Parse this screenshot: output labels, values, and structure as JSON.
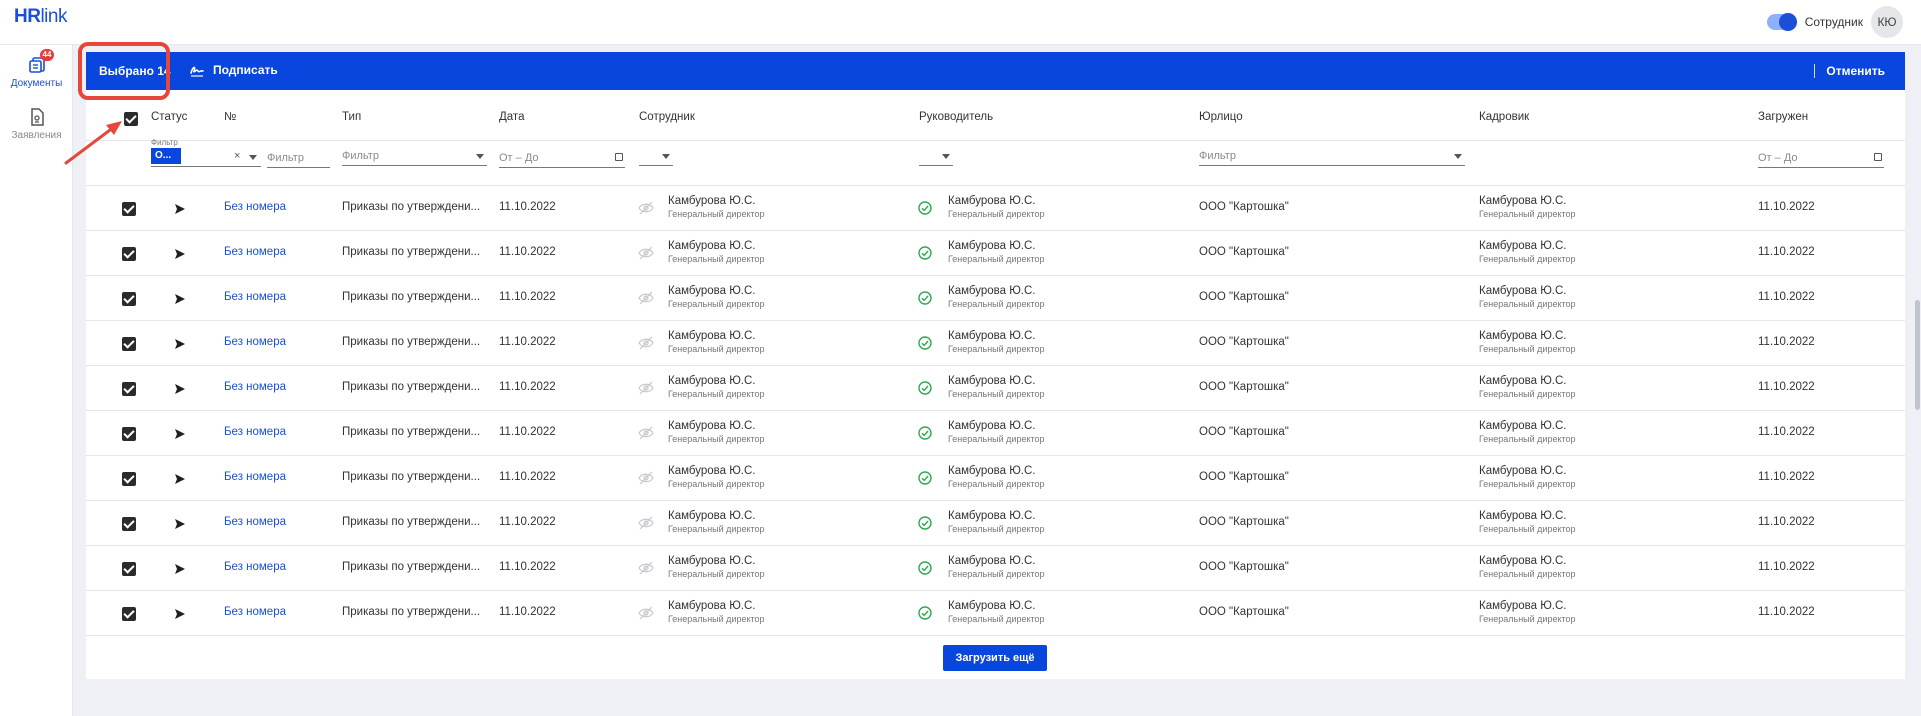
{
  "app": {
    "logo_hr": "HR",
    "logo_link": "link"
  },
  "topbar": {
    "role_label": "Сотрудник",
    "avatar_initials": "КЮ",
    "toggle_on": true
  },
  "sidebar": {
    "items": [
      {
        "label": "Документы",
        "badge": "44",
        "icon": "documents-icon",
        "active": true
      },
      {
        "label": "Заявления",
        "icon": "application-icon",
        "active": false
      }
    ]
  },
  "actionbar": {
    "selected_label": "Выбрано 14",
    "sign_label": "Подписать",
    "cancel_label": "Отменить"
  },
  "table": {
    "columns": [
      "Статус",
      "№",
      "Тип",
      "Дата",
      "Сотрудник",
      "Руководитель",
      "Юрлицо",
      "Кадровик",
      "Загружен"
    ],
    "filters": {
      "status_label": "Фильтр",
      "status_chip": "О...",
      "number_placeholder": "Фильтр",
      "type_placeholder": "Фильтр",
      "date_placeholder": "От – До",
      "legal_placeholder": "Фильтр",
      "uploaded_placeholder": "От – До"
    },
    "rows": [
      {
        "number": "Без номера",
        "type": "Приказы по утверждени...",
        "date": "11.10.2022",
        "employee_name": "Камбурова Ю.С.",
        "employee_pos": "Генеральный директор",
        "manager_name": "Камбурова Ю.С.",
        "manager_pos": "Генеральный директор",
        "legal": "ООО \"Картошка\"",
        "hr_name": "Камбурова Ю.С.",
        "hr_pos": "Генеральный директор",
        "uploaded": "11.10.2022"
      },
      {
        "number": "Без номера",
        "type": "Приказы по утверждени...",
        "date": "11.10.2022",
        "employee_name": "Камбурова Ю.С.",
        "employee_pos": "Генеральный директор",
        "manager_name": "Камбурова Ю.С.",
        "manager_pos": "Генеральный директор",
        "legal": "ООО \"Картошка\"",
        "hr_name": "Камбурова Ю.С.",
        "hr_pos": "Генеральный директор",
        "uploaded": "11.10.2022"
      },
      {
        "number": "Без номера",
        "type": "Приказы по утверждени...",
        "date": "11.10.2022",
        "employee_name": "Камбурова Ю.С.",
        "employee_pos": "Генеральный директор",
        "manager_name": "Камбурова Ю.С.",
        "manager_pos": "Генеральный директор",
        "legal": "ООО \"Картошка\"",
        "hr_name": "Камбурова Ю.С.",
        "hr_pos": "Генеральный директор",
        "uploaded": "11.10.2022"
      },
      {
        "number": "Без номера",
        "type": "Приказы по утверждени...",
        "date": "11.10.2022",
        "employee_name": "Камбурова Ю.С.",
        "employee_pos": "Генеральный директор",
        "manager_name": "Камбурова Ю.С.",
        "manager_pos": "Генеральный директор",
        "legal": "ООО \"Картошка\"",
        "hr_name": "Камбурова Ю.С.",
        "hr_pos": "Генеральный директор",
        "uploaded": "11.10.2022"
      },
      {
        "number": "Без номера",
        "type": "Приказы по утверждени...",
        "date": "11.10.2022",
        "employee_name": "Камбурова Ю.С.",
        "employee_pos": "Генеральный директор",
        "manager_name": "Камбурова Ю.С.",
        "manager_pos": "Генеральный директор",
        "legal": "ООО \"Картошка\"",
        "hr_name": "Камбурова Ю.С.",
        "hr_pos": "Генеральный директор",
        "uploaded": "11.10.2022"
      },
      {
        "number": "Без номера",
        "type": "Приказы по утверждени...",
        "date": "11.10.2022",
        "employee_name": "Камбурова Ю.С.",
        "employee_pos": "Генеральный директор",
        "manager_name": "Камбурова Ю.С.",
        "manager_pos": "Генеральный директор",
        "legal": "ООО \"Картошка\"",
        "hr_name": "Камбурова Ю.С.",
        "hr_pos": "Генеральный директор",
        "uploaded": "11.10.2022"
      },
      {
        "number": "Без номера",
        "type": "Приказы по утверждени...",
        "date": "11.10.2022",
        "employee_name": "Камбурова Ю.С.",
        "employee_pos": "Генеральный директор",
        "manager_name": "Камбурова Ю.С.",
        "manager_pos": "Генеральный директор",
        "legal": "ООО \"Картошка\"",
        "hr_name": "Камбурова Ю.С.",
        "hr_pos": "Генеральный директор",
        "uploaded": "11.10.2022"
      },
      {
        "number": "Без номера",
        "type": "Приказы по утверждени...",
        "date": "11.10.2022",
        "employee_name": "Камбурова Ю.С.",
        "employee_pos": "Генеральный директор",
        "manager_name": "Камбурова Ю.С.",
        "manager_pos": "Генеральный директор",
        "legal": "ООО \"Картошка\"",
        "hr_name": "Камбурова Ю.С.",
        "hr_pos": "Генеральный директор",
        "uploaded": "11.10.2022"
      },
      {
        "number": "Без номера",
        "type": "Приказы по утверждени...",
        "date": "11.10.2022",
        "employee_name": "Камбурова Ю.С.",
        "employee_pos": "Генеральный директор",
        "manager_name": "Камбурова Ю.С.",
        "manager_pos": "Генеральный директор",
        "legal": "ООО \"Картошка\"",
        "hr_name": "Камбурова Ю.С.",
        "hr_pos": "Генеральный директор",
        "uploaded": "11.10.2022"
      },
      {
        "number": "Без номера",
        "type": "Приказы по утверждени...",
        "date": "11.10.2022",
        "employee_name": "Камбурова Ю.С.",
        "employee_pos": "Генеральный директор",
        "manager_name": "Камбурова Ю.С.",
        "manager_pos": "Генеральный директор",
        "legal": "ООО \"Картошка\"",
        "hr_name": "Камбурова Ю.С.",
        "hr_pos": "Генеральный директор",
        "uploaded": "11.10.2022"
      }
    ]
  },
  "load_more_label": "Загрузить ещё",
  "colors": {
    "accent": "#0846dd",
    "highlight": "#e5473b",
    "ok": "#2fa84f",
    "link": "#1a4fd6"
  }
}
